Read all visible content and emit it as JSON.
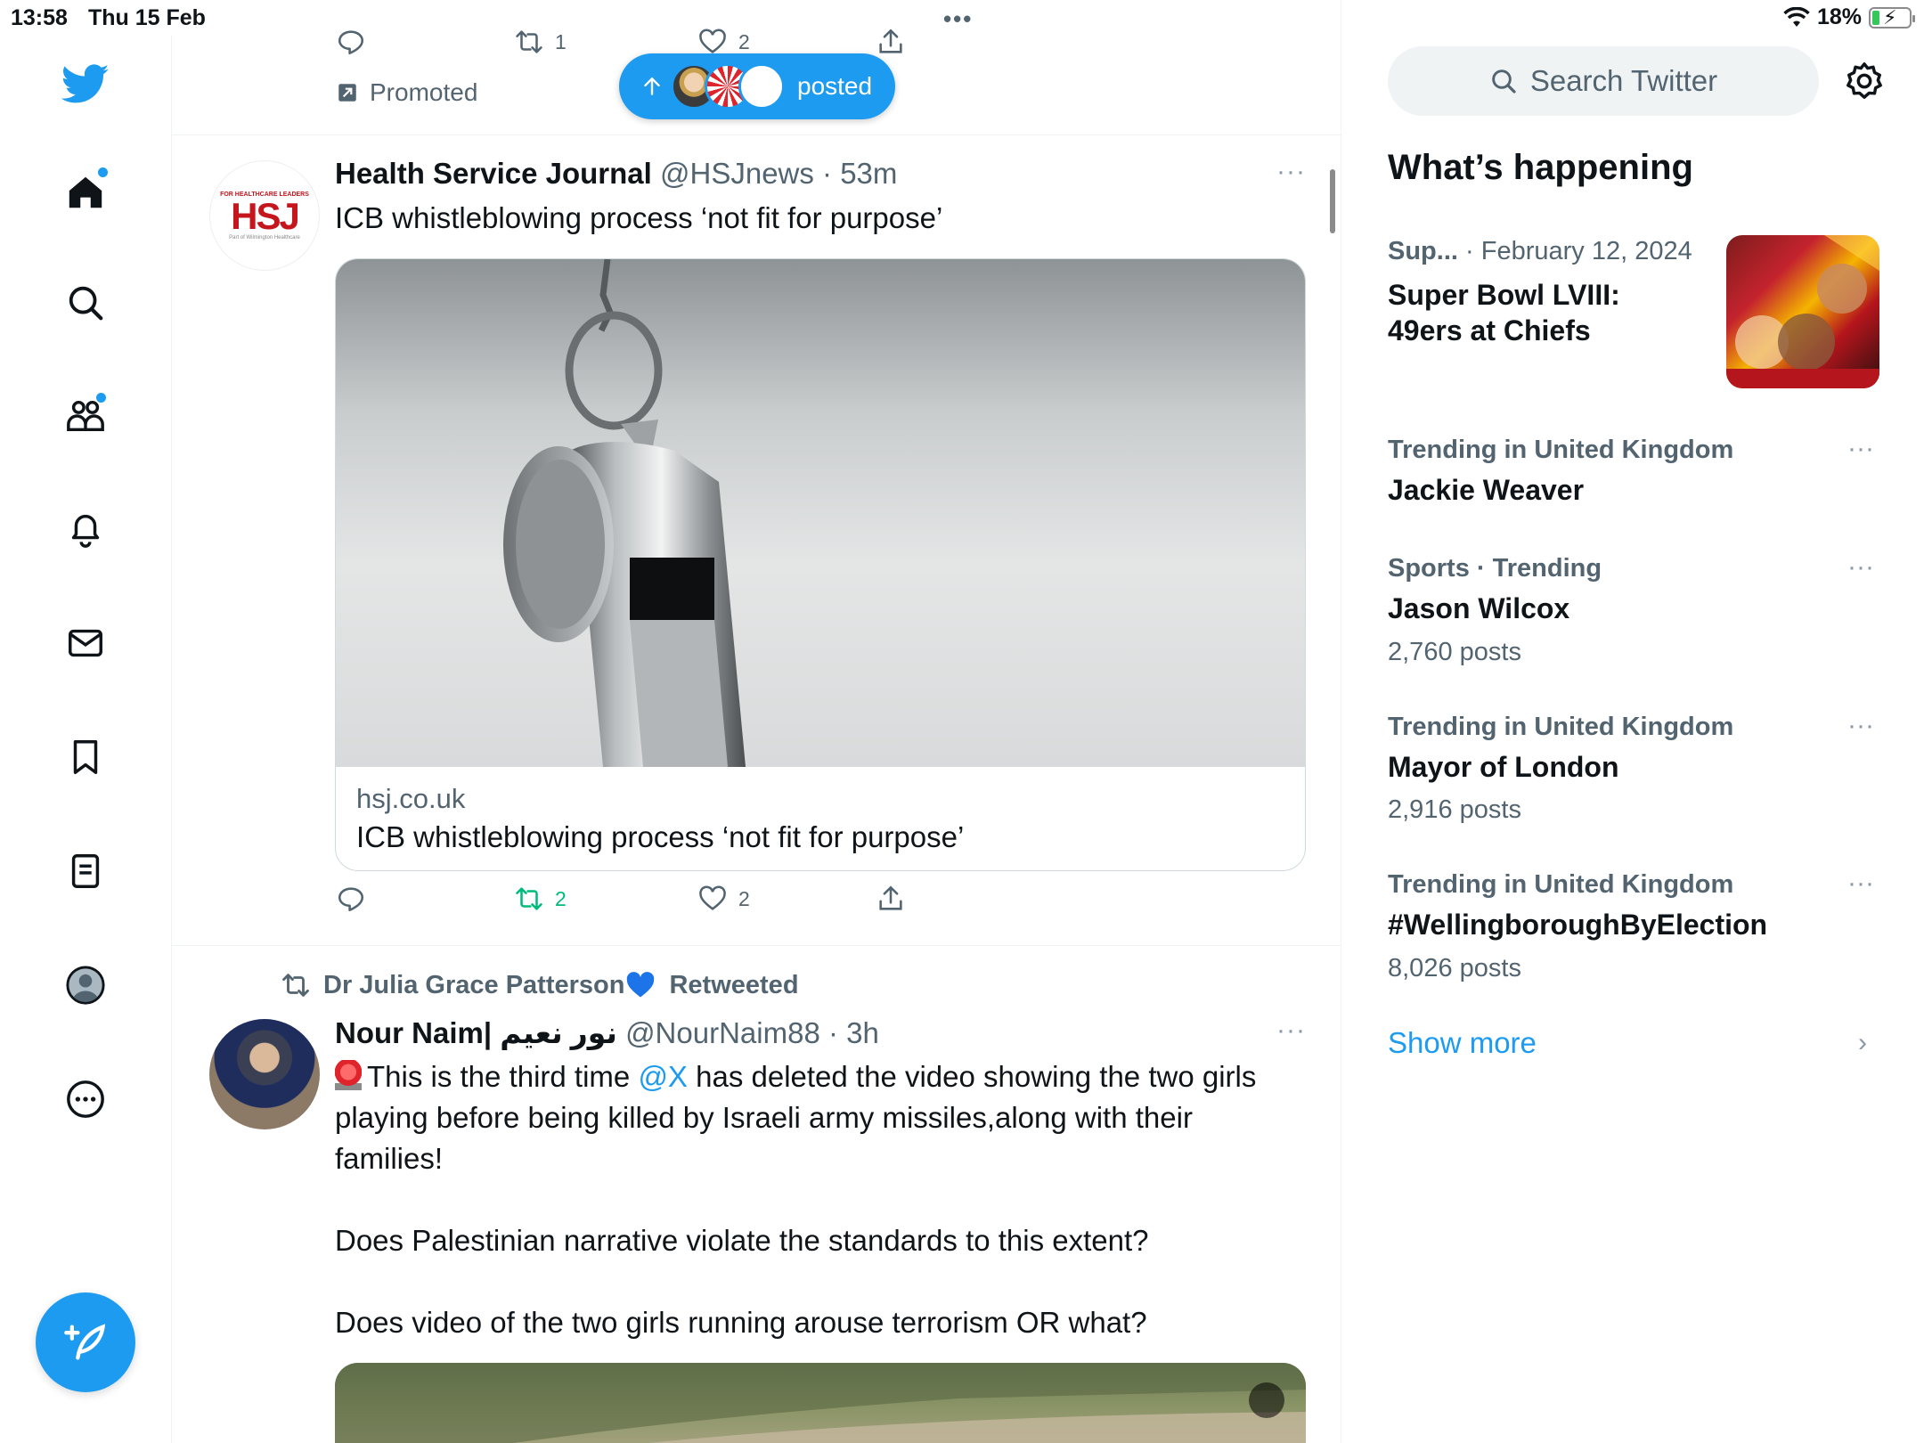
{
  "status_bar": {
    "time": "13:58",
    "date": "Thu 15 Feb",
    "battery": "18%",
    "dots": "•••"
  },
  "colors": {
    "accent": "#1d9bf0",
    "retweet_green": "#00ba7c",
    "text": "#0f1419",
    "secondary": "#536471"
  },
  "nav": {
    "items": [
      {
        "name": "home",
        "icon": "home-icon",
        "badge": true
      },
      {
        "name": "explore",
        "icon": "search-icon",
        "badge": false
      },
      {
        "name": "communities",
        "icon": "communities-icon",
        "badge": true
      },
      {
        "name": "notifications",
        "icon": "bell-icon",
        "badge": false
      },
      {
        "name": "messages",
        "icon": "mail-icon",
        "badge": false
      },
      {
        "name": "bookmarks",
        "icon": "bookmark-icon",
        "badge": false
      },
      {
        "name": "lists",
        "icon": "list-icon",
        "badge": false
      },
      {
        "name": "profile",
        "icon": "profile-icon",
        "badge": false
      },
      {
        "name": "more",
        "icon": "more-circle-icon",
        "badge": false
      }
    ]
  },
  "top_strip": {
    "retweets": "1",
    "likes": "2",
    "promoted_label": "Promoted",
    "posted_pill_label": "posted"
  },
  "tweet1": {
    "name": "Health Service Journal",
    "handle_time": "@HSJnews · 53m",
    "text": "ICB whistleblowing process ‘not fit for purpose’",
    "avatar_top": "FOR HEALTHCARE LEADERS",
    "avatar_logo": "HSJ",
    "avatar_bottom": "Part of Wilmington Healthcare",
    "card_domain": "hsj.co.uk",
    "card_title": "ICB whistleblowing process ‘not fit for purpose’",
    "retweets": "2",
    "likes": "2",
    "more": "···"
  },
  "tweet2": {
    "retweeted_by": "Dr Julia Grace Patterson",
    "retweeted_label": "Retweeted",
    "name": "Nour Naim| نور نعيم",
    "handle_time": "@NourNaim88 · 3h",
    "line1_prefix": "This is the third time",
    "mention": "@X",
    "line1_suffix": "has deleted the video showing the two girls",
    "line2": "playing before being killed by Israeli army missiles,along with their",
    "line3": "families!",
    "line4": "Does Palestinian narrative violate the standards to this extent?",
    "line5": "Does video of the two girls running arouse terrorism OR what?",
    "more": "···"
  },
  "right": {
    "search_placeholder": "Search Twitter",
    "whats_happening": "What’s happening",
    "trends": [
      {
        "meta_a": "Sup...",
        "meta_b": "· February 12, 2024",
        "title_l1": "Super Bowl LVIII:",
        "title_l2": "49ers at Chiefs"
      },
      {
        "meta": "Trending in United Kingdom",
        "title": "Jackie Weaver",
        "count": ""
      },
      {
        "meta": "Sports · Trending",
        "title": "Jason Wilcox",
        "count": "2,760 posts"
      },
      {
        "meta": "Trending in United Kingdom",
        "title": "Mayor of London",
        "count": "2,916 posts"
      },
      {
        "meta": "Trending in United Kingdom",
        "title": "#WellingboroughByElection",
        "count": "8,026 posts"
      }
    ],
    "show_more": "Show more",
    "more": "···"
  }
}
